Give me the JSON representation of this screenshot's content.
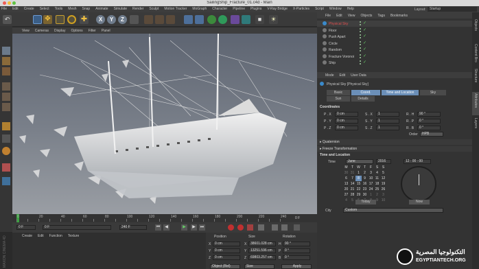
{
  "window": {
    "title": "SailingShip_Fracture_01.c4d - Main",
    "layout_label": "Layout:",
    "layout_value": "Startup"
  },
  "menubar": [
    "File",
    "Edit",
    "Create",
    "Select",
    "Tools",
    "Mesh",
    "Snap",
    "Animate",
    "Simulate",
    "Render",
    "Sculpt",
    "Motion Tracker",
    "MoGraph",
    "Character",
    "Pipeline",
    "Plugins",
    "V-Ray Bridge",
    "X-Particles",
    "Script",
    "Window",
    "Help"
  ],
  "toolbar": {
    "axis_x": "X",
    "axis_y": "Y",
    "axis_z": "Z"
  },
  "viewport_menu": [
    "View",
    "Cameras",
    "Display",
    "Options",
    "Filter",
    "Panel"
  ],
  "objects_menu": [
    "File",
    "Edit",
    "View",
    "Objects",
    "Tags",
    "Bookmarks"
  ],
  "objects": [
    {
      "name": "Physical Sky",
      "color": "#e05050"
    },
    {
      "name": "Floor",
      "color": "#cccccc"
    },
    {
      "name": "Push Apart",
      "color": "#cccccc"
    },
    {
      "name": "Circle",
      "color": "#cccccc"
    },
    {
      "name": "Random",
      "color": "#cccccc"
    },
    {
      "name": "Fracture Voronoi",
      "color": "#cccccc"
    },
    {
      "name": "Ship",
      "color": "#cccccc"
    }
  ],
  "right_tabs": [
    "Objects",
    "Content Bro",
    "Structure",
    "Attributes",
    "Layers"
  ],
  "attributes": {
    "menu": [
      "Mode",
      "Edit",
      "User Data"
    ],
    "header": "Physical Sky [Physical Sky]",
    "tabs_row1": [
      "Basic",
      "Coord.",
      "Time and Location",
      "Sky"
    ],
    "tabs_row2": [
      "Sun",
      "Details"
    ],
    "coordinates_label": "Coordinates",
    "coords": [
      {
        "a": "P . X",
        "av": "0 cm",
        "b": "S . X",
        "bv": "1",
        "c": "R . H",
        "cv": "90 °"
      },
      {
        "a": "P . Y",
        "av": "0 cm",
        "b": "S . Y",
        "bv": "1",
        "c": "R . P",
        "cv": "0 °"
      },
      {
        "a": "P . Z",
        "av": "0 cm",
        "b": "S . Z",
        "bv": "1",
        "c": "R . B",
        "cv": "0 °"
      }
    ],
    "order_label": "Order",
    "order_value": "HPB",
    "quaternion": "Quaternion",
    "freeze": "Freeze Transformation",
    "time_location": "Time and Location",
    "time_label": "Time",
    "month": "June",
    "year": "2016",
    "clock": "12 : 00 : 00",
    "weekdays": [
      "M",
      "T",
      "W",
      "T",
      "F",
      "S",
      "S"
    ],
    "calendar": [
      [
        "30",
        "31",
        "1",
        "2",
        "3",
        "4",
        "5"
      ],
      [
        "6",
        "7",
        "8",
        "9",
        "10",
        "11",
        "12"
      ],
      [
        "13",
        "14",
        "15",
        "16",
        "17",
        "18",
        "19"
      ],
      [
        "20",
        "21",
        "22",
        "23",
        "24",
        "25",
        "26"
      ],
      [
        "27",
        "28",
        "29",
        "30",
        "1",
        "2",
        "3"
      ],
      [
        "4",
        "5",
        "6",
        "7",
        "8",
        "9",
        "10"
      ]
    ],
    "today_button": "Today",
    "now_button": "Now",
    "city_label": "City",
    "city_value": "Custom"
  },
  "timeline": {
    "ticks": [
      "0",
      "10",
      "20",
      "30",
      "40",
      "50",
      "60",
      "70",
      "80",
      "90",
      "100",
      "110",
      "120",
      "130",
      "140",
      "150",
      "160",
      "170",
      "180",
      "190",
      "200",
      "210",
      "220",
      "230",
      "240"
    ],
    "frame_start": "0 F",
    "frame_cur": "0 F",
    "frame_end": "240 F",
    "frame_end2": "240 F",
    "current": "0 F"
  },
  "materials_menu": [
    "Create",
    "Edit",
    "Function",
    "Texture"
  ],
  "coord_mgr": {
    "headers": [
      "Position",
      "Size",
      "Rotation"
    ],
    "rows": [
      {
        "a": "X",
        "av": "0 cm",
        "b": "X",
        "bv": "38601.028 cm",
        "c": "H",
        "cv": "90 °"
      },
      {
        "a": "Y",
        "av": "0 cm",
        "b": "Y",
        "bv": "13251.596 cm",
        "c": "P",
        "cv": "0 °"
      },
      {
        "a": "Z",
        "av": "0 cm",
        "b": "Z",
        "bv": "69803.257 cm",
        "c": "B",
        "cv": "0 °"
      }
    ],
    "object_select": "Object (Rel)",
    "size_select": "Size",
    "apply": "Apply"
  },
  "watermark": {
    "arabic": "التكنولوجيا المصرية",
    "latin": "EGYPTIANTECH.ORG"
  },
  "sidebar_brand": "MAXON CINEMA 4D"
}
